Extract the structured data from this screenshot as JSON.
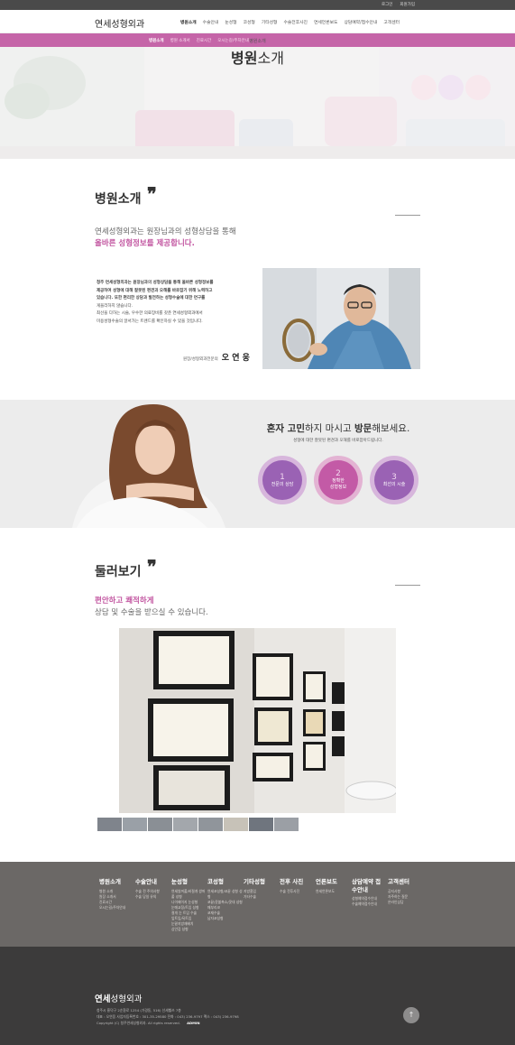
{
  "topbar": {
    "login": "로그인",
    "join": "회원가입"
  },
  "header": {
    "logo_bold": "연세",
    "logo_rest": "성형외과",
    "nav": [
      "병원소개",
      "수술안내",
      "눈성형",
      "코성형",
      "기타성형",
      "수술전후사진",
      "연세언론보도",
      "상담예약/접수안내",
      "고객센터"
    ]
  },
  "subnav": {
    "items": [
      "병원소개",
      "병원 소개서",
      "진료시간",
      "오시는길/주차안내"
    ]
  },
  "hero": {
    "sub": "병원소개",
    "title_bold": "병원",
    "title_rest": "소개"
  },
  "intro": {
    "title": "병원소개",
    "quote": "❞",
    "lead1": "연세성형외과는 원장님과의 성형상담을 통해",
    "lead2": "올바른 성형정보를 제공합니다.",
    "body": [
      "청주 연세성형외과는 원장님과의 성형상담을 통해 올바른 성형정보를",
      "제공하여 성형에 대해 잘못된 편견과 오해를 바로잡기 위해 노력하고",
      "있습니다. 또한 편리한 상담과 발전하는 성형수술에 대한 연구를",
      "게을리하지 않습니다.",
      "최선을 다하는 시술, 우수한 의료장비를 갖춘 연세성형외과에서",
      "미용성형수술의 알서가는 트렌드를 확인하실 수 있을 것입니다."
    ],
    "sign_role": "원장/성형외과전문의",
    "sign_name": "오 연 웅"
  },
  "consult": {
    "title_b1": "혼자 고민",
    "title_t1": "하지 마시고 ",
    "title_b2": "방문",
    "title_t2": "해보세요.",
    "sub": "성형에 대한 잘못된 편견과 오해를 바로잡아드립니다.",
    "circles": [
      {
        "num": "1",
        "label": "전문의 상담",
        "color": "#9a62b4"
      },
      {
        "num": "2",
        "label": "정확한\n성형정보",
        "color": "#c35aa6"
      },
      {
        "num": "3",
        "label": "최선의 시술",
        "color": "#9a62b4"
      }
    ]
  },
  "tour": {
    "title": "둘러보기",
    "quote": "❞",
    "lead1": "편안하고 쾌적하게",
    "lead2": "상담 및 수술을 받으실 수 있습니다."
  },
  "footer": {
    "cols": [
      {
        "h": "병원소개",
        "items": [
          "병원 소개",
          "원장 소개서",
          "진료시간",
          "오시는길/주차안내"
        ]
      },
      {
        "h": "수술안내",
        "items": [
          "수술 전 주의사항",
          "수술 당일 유의"
        ]
      },
      {
        "h": "눈성형",
        "items": [
          "연세쌍꺼풀/비절개 쌍꺼풀 성형",
          "나이배이지 눈성형",
          "눈매교정/트임 성형",
          "절개 눈 트임 수술",
          "앞트임/뒤트임",
          "눈밑지방재배치",
          "상안검 성형"
        ]
      },
      {
        "h": "코성형",
        "items": [
          "연세코성형/코끝 성형 성형",
          "코끝/콧볼축소/콧대 성형",
          "매부리코",
          "코재수술",
          "남자코성형"
        ]
      },
      {
        "h": "기타성형",
        "items": [
          "지방흡입",
          "기타수술"
        ]
      },
      {
        "h": "전후 사진",
        "items": [
          "수술 전후사진"
        ]
      },
      {
        "h": "언론보도",
        "items": [
          "연세언론보도"
        ]
      },
      {
        "h": "상담예약 접수안내",
        "items": [
          "성형예약접수안내",
          "수술예약접수안내"
        ]
      },
      {
        "h": "고객센터",
        "items": [
          "공지사항",
          "자주하는 질문",
          "온라인상담"
        ]
      }
    ],
    "logo_bold": "연세",
    "logo_rest": "성형외과",
    "info1": "청주시 흥덕구 2순환로 1254 (가경동, 516) 선세헬쓰 7층",
    "info2": "대표 : 오연웅     사업자등록번호 : 301-35-29580     전화 : 043) 236-9797     팩스 : 043) 236-9798",
    "copyright": "Copyright (C) 청주연세성형외과. All rights reserved.",
    "admin": "ADMIN",
    "totop": "↑"
  }
}
